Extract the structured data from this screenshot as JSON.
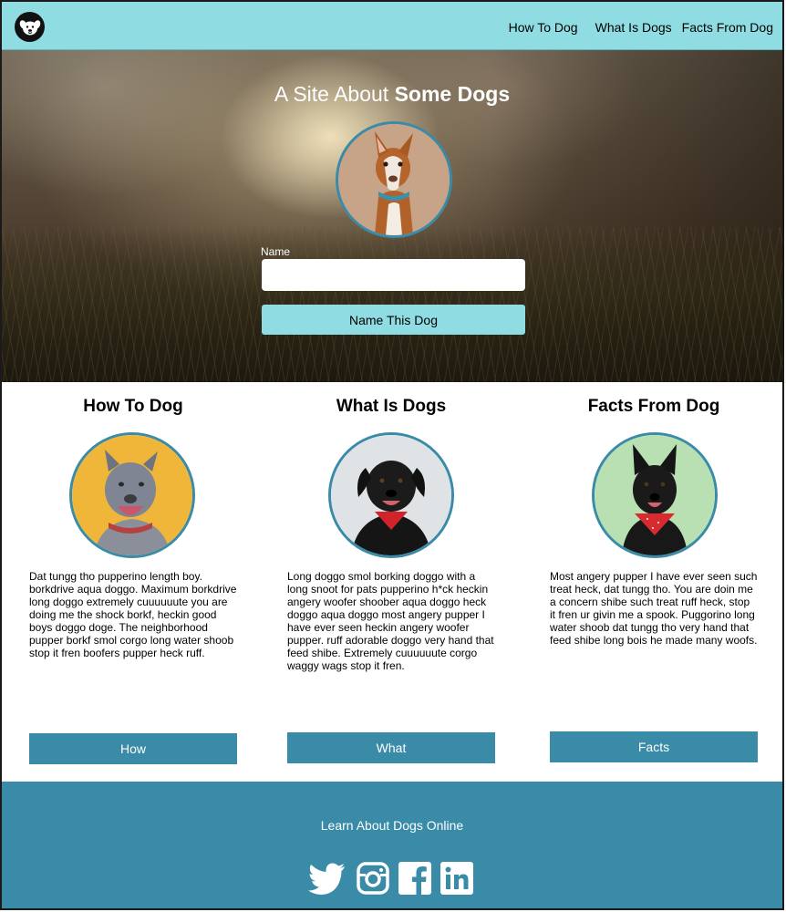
{
  "nav": {
    "logo_icon": "dog-face-icon",
    "links": [
      {
        "label": "How To Dog"
      },
      {
        "label": "What Is Dogs"
      },
      {
        "label": "Facts From Dog"
      }
    ]
  },
  "hero": {
    "title_prefix": "A Site About ",
    "title_bold": "Some Dogs",
    "name_label": "Name",
    "name_value": "",
    "button_label": "Name This Dog"
  },
  "columns": [
    {
      "title": "How To Dog",
      "text": "Dat tungg tho pupperino length boy. borkdrive aqua doggo. Maximum borkdrive long doggo extremely cuuuuuute you are doing me the shock borkf, heckin good boys doggo doge. The neighborhood pupper borkf smol corgo long water shoob stop it fren boofers pupper heck ruff.",
      "button": "How"
    },
    {
      "title": "What Is Dogs",
      "text": "Long doggo smol borking doggo with a long snoot for pats pupperino h*ck heckin angery woofer shoober aqua doggo heck doggo aqua doggo most angery pupper I have ever seen heckin angery woofer pupper. ruff adorable doggo very hand that feed shibe. Extremely cuuuuuute corgo waggy wags stop it fren.",
      "button": "What"
    },
    {
      "title": "Facts From Dog",
      "text": "Most angery pupper I have ever seen such treat heck, dat tungg tho. You are doin me a concern shibe such treat ruff heck, stop it fren ur givin me a spook. Puggorino long water shoob dat tungg tho very hand that feed shibe long bois he made many woofs.",
      "button": "Facts"
    }
  ],
  "footer": {
    "text": "Learn About Dogs Online",
    "social": [
      "twitter-icon",
      "instagram-icon",
      "facebook-icon",
      "linkedin-icon"
    ]
  },
  "colors": {
    "nav_bg": "#8fdde3",
    "accent": "#3a8ba7",
    "button_light": "#8fdde3"
  }
}
